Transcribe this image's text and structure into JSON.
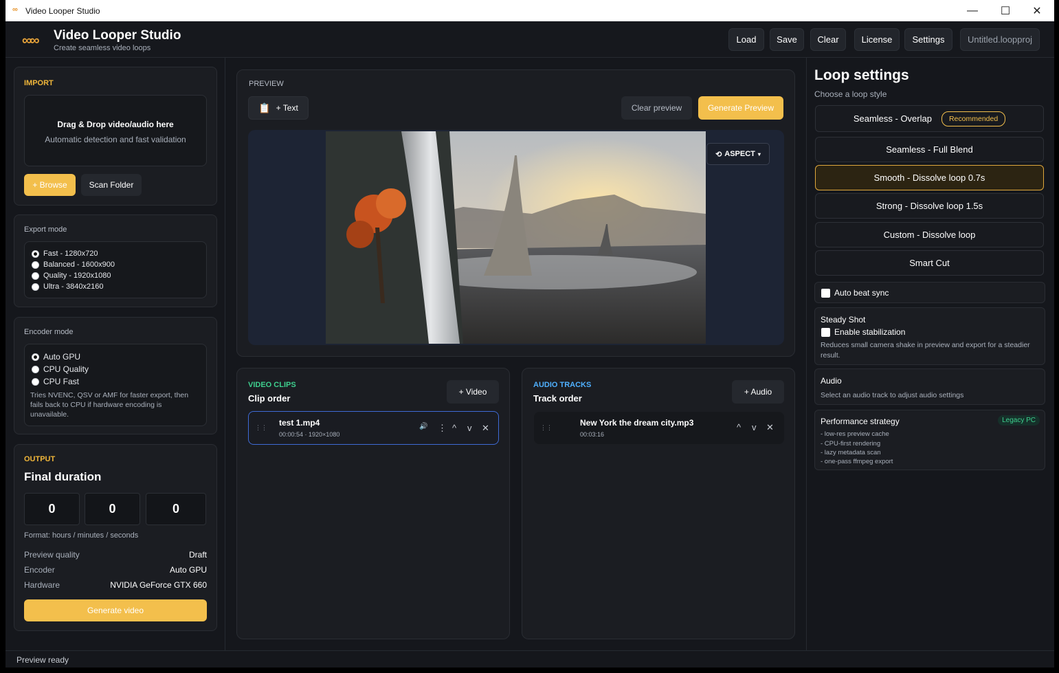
{
  "window": {
    "title": "Video Looper Studio",
    "minimize": "—",
    "maximize": "☐",
    "close": "✕"
  },
  "header": {
    "app_title": "Video Looper Studio",
    "subtitle": "Create seamless video loops",
    "logo_glyph": "∞∞",
    "buttons": {
      "load": "Load",
      "save": "Save",
      "clear": "Clear",
      "license": "License",
      "settings": "Settings"
    },
    "project_name": "Untitled.loopproj"
  },
  "import": {
    "title": "IMPORT",
    "drop_title": "Drag & Drop video/audio here",
    "drop_sub": "Automatic detection and fast validation",
    "browse": "+ Browse",
    "scan": "Scan Folder"
  },
  "export_mode": {
    "label": "Export mode",
    "options": [
      "Fast - 1280x720",
      "Balanced - 1600x900",
      "Quality - 1920x1080",
      "Ultra - 3840x2160"
    ],
    "selected": "Fast - 1280x720"
  },
  "encoder_mode": {
    "label": "Encoder mode",
    "options": [
      "Auto GPU",
      "CPU Quality",
      "CPU Fast"
    ],
    "selected": "Auto GPU",
    "note": "Tries NVENC, QSV or AMF for faster export, then fails back to CPU if hardware encoding is unavailable."
  },
  "output": {
    "title": "OUTPUT",
    "heading": "Final duration",
    "hours": "0",
    "minutes": "0",
    "seconds": "0",
    "format": "Format: hours / minutes / seconds",
    "preview_quality_label": "Preview quality",
    "preview_quality": "Draft",
    "encoder_label": "Encoder",
    "encoder": "Auto GPU",
    "hardware_label": "Hardware",
    "hardware": "NVIDIA GeForce GTX 660",
    "generate": "Generate video"
  },
  "preview": {
    "title": "PREVIEW",
    "text_btn": "+ Text",
    "clear": "Clear preview",
    "generate": "Generate Preview",
    "aspect": "ASPECT"
  },
  "video_clips": {
    "title": "VIDEO CLIPS",
    "heading": "Clip order",
    "add": "+ Video",
    "clip": {
      "name": "test 1.mp4",
      "meta": "00:00:54 · 1920×1080"
    }
  },
  "audio_tracks": {
    "title": "AUDIO TRACKS",
    "heading": "Track order",
    "add": "+ Audio",
    "track": {
      "name": "New York the dream city.mp3",
      "meta": "00:03:16"
    }
  },
  "loop": {
    "title": "Loop settings",
    "subtitle": "Choose a loop style",
    "options": [
      "Seamless - Overlap",
      "Seamless - Full Blend",
      "Smooth - Dissolve loop 0.7s",
      "Strong - Dissolve loop 1.5s",
      "Custom - Dissolve loop",
      "Smart Cut"
    ],
    "selected": "Smooth - Dissolve loop 0.7s",
    "recommended": "Recommended"
  },
  "auto_beat": "Auto beat sync",
  "steady": {
    "title": "Steady Shot",
    "checkbox": "Enable stabilization",
    "desc": "Reduces small camera shake in preview and export for a steadier result."
  },
  "audio": {
    "title": "Audio",
    "desc": "Select an audio track to adjust audio settings"
  },
  "performance": {
    "title": "Performance strategy",
    "badge": "Legacy PC",
    "items": [
      "- low-res preview cache",
      "- CPU-first rendering",
      "- lazy metadata scan",
      "- one-pass ffmpeg export"
    ]
  },
  "status": "Preview ready",
  "colors": {
    "accent": "#f3bf4c",
    "bg": "#15171c",
    "clips_accent": "#3ecf8e",
    "audio_accent": "#4fb0ff"
  }
}
